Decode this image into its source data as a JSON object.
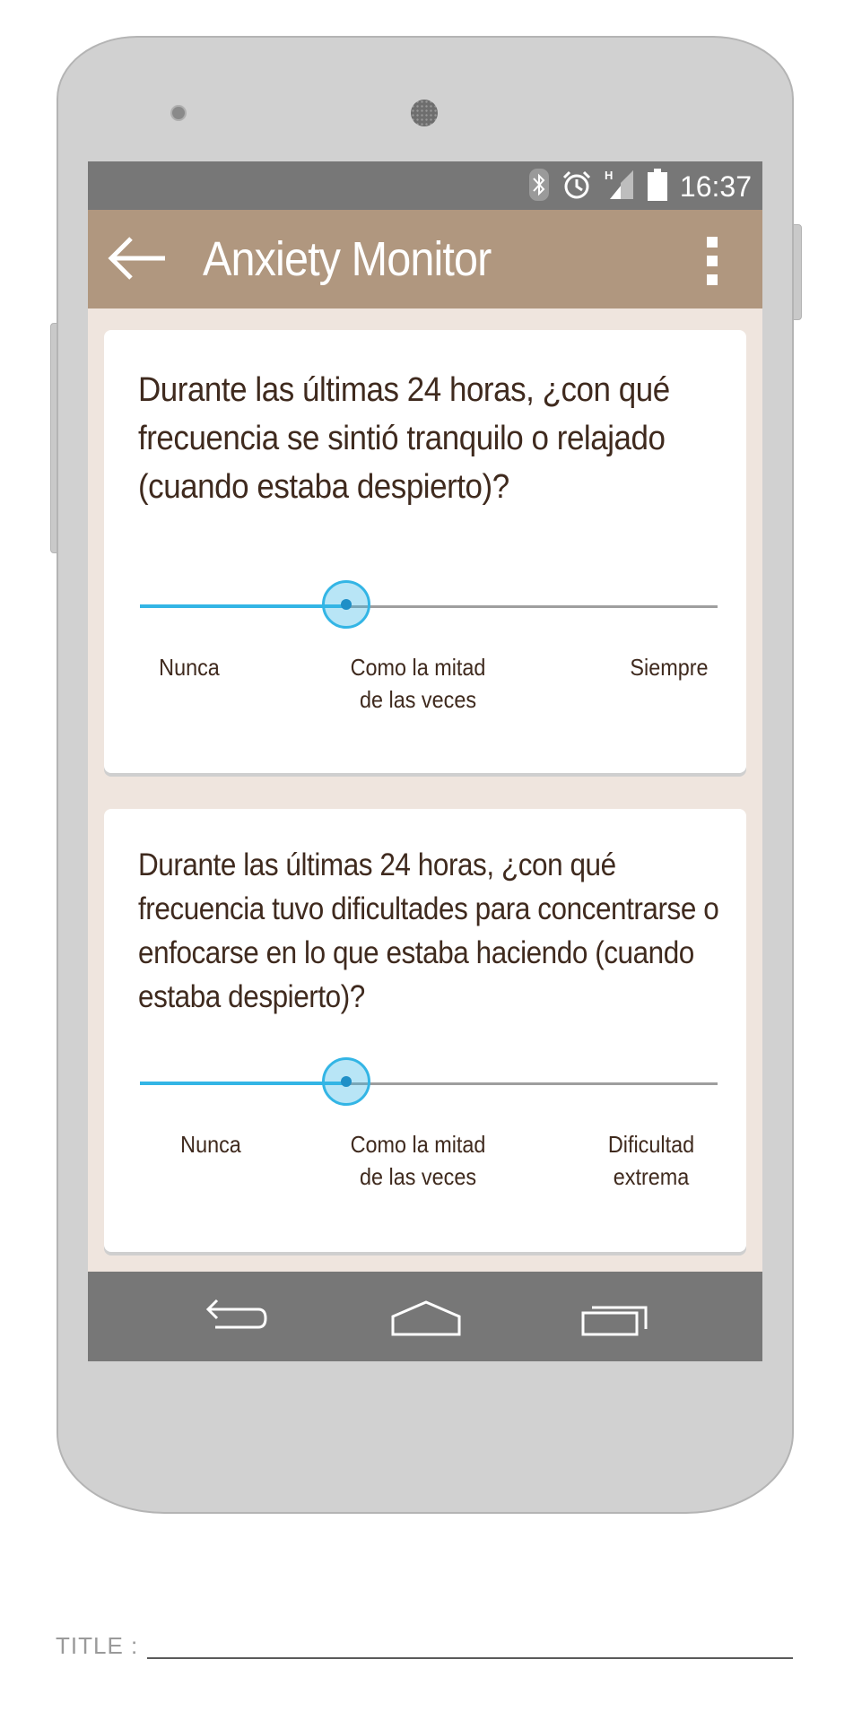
{
  "status_bar": {
    "time": "16:37",
    "icons": [
      "bluetooth-icon",
      "alarm-icon",
      "signal-icon",
      "battery-icon"
    ],
    "network_type": "H"
  },
  "app_bar": {
    "title": "Anxiety Monitor",
    "back_icon": "back-arrow-icon",
    "menu_icon": "overflow-menu-icon"
  },
  "questions": [
    {
      "text": "Durante las últimas 24 horas, ¿con qué frecuencia se sintió tranquilo o relajado (cuando estaba despierto)?",
      "value": 0.36,
      "labels": {
        "left": "Nunca",
        "middle_line1": "Como la mitad",
        "middle_line2": "de las veces",
        "right_line1": "Siempre",
        "right_line2": ""
      }
    },
    {
      "text": "Durante las últimas 24 horas, ¿con qué frecuencia tuvo dificultades para concentrarse o enfocarse en lo que estaba haciendo (cuando estaba despierto)?",
      "value": 0.36,
      "labels": {
        "left": "Nunca",
        "middle_line1": "Como la mitad",
        "middle_line2": "de las veces",
        "right_line1": "Dificultad",
        "right_line2": "extrema"
      }
    }
  ],
  "nav_bar": {
    "buttons": [
      "back-nav-icon",
      "home-nav-icon",
      "recents-nav-icon"
    ]
  },
  "footer": {
    "title_label": "TITLE :"
  },
  "colors": {
    "app_bar": "#b0977f",
    "status_bar": "#777777",
    "background": "#efe5de",
    "accent": "#33b5e5",
    "text": "#3f2a1e"
  }
}
